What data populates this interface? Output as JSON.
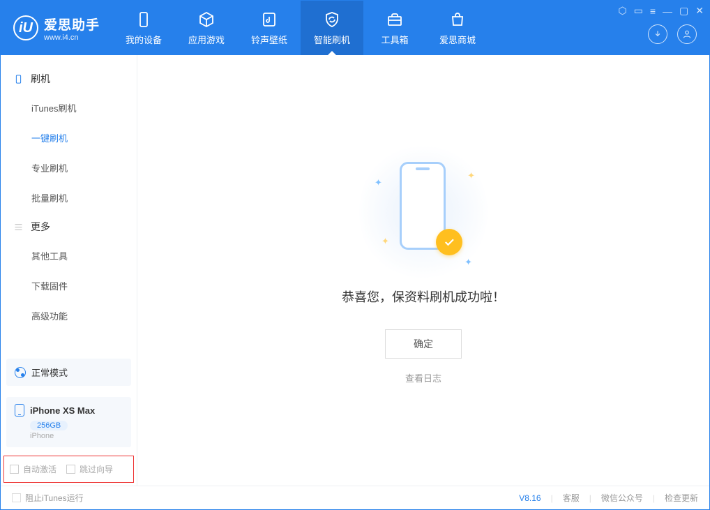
{
  "app": {
    "title": "爱思助手",
    "subtitle": "www.i4.cn"
  },
  "tabs": {
    "device": "我的设备",
    "apps": "应用游戏",
    "ringtone": "铃声壁纸",
    "flash": "智能刷机",
    "toolbox": "工具箱",
    "store": "爱思商城"
  },
  "sidebar": {
    "section_flash": "刷机",
    "itunes_flash": "iTunes刷机",
    "one_click": "一键刷机",
    "pro_flash": "专业刷机",
    "batch_flash": "批量刷机",
    "section_more": "更多",
    "other_tools": "其他工具",
    "download_fw": "下载固件",
    "advanced": "高级功能"
  },
  "device": {
    "mode": "正常模式",
    "name": "iPhone XS Max",
    "storage": "256GB",
    "type": "iPhone"
  },
  "options": {
    "auto_activate": "自动激活",
    "skip_guide": "跳过向导"
  },
  "main": {
    "success": "恭喜您，保资料刷机成功啦！",
    "ok": "确定",
    "view_log": "查看日志"
  },
  "footer": {
    "block_itunes": "阻止iTunes运行",
    "version": "V8.16",
    "support": "客服",
    "wechat": "微信公众号",
    "update": "检查更新"
  }
}
